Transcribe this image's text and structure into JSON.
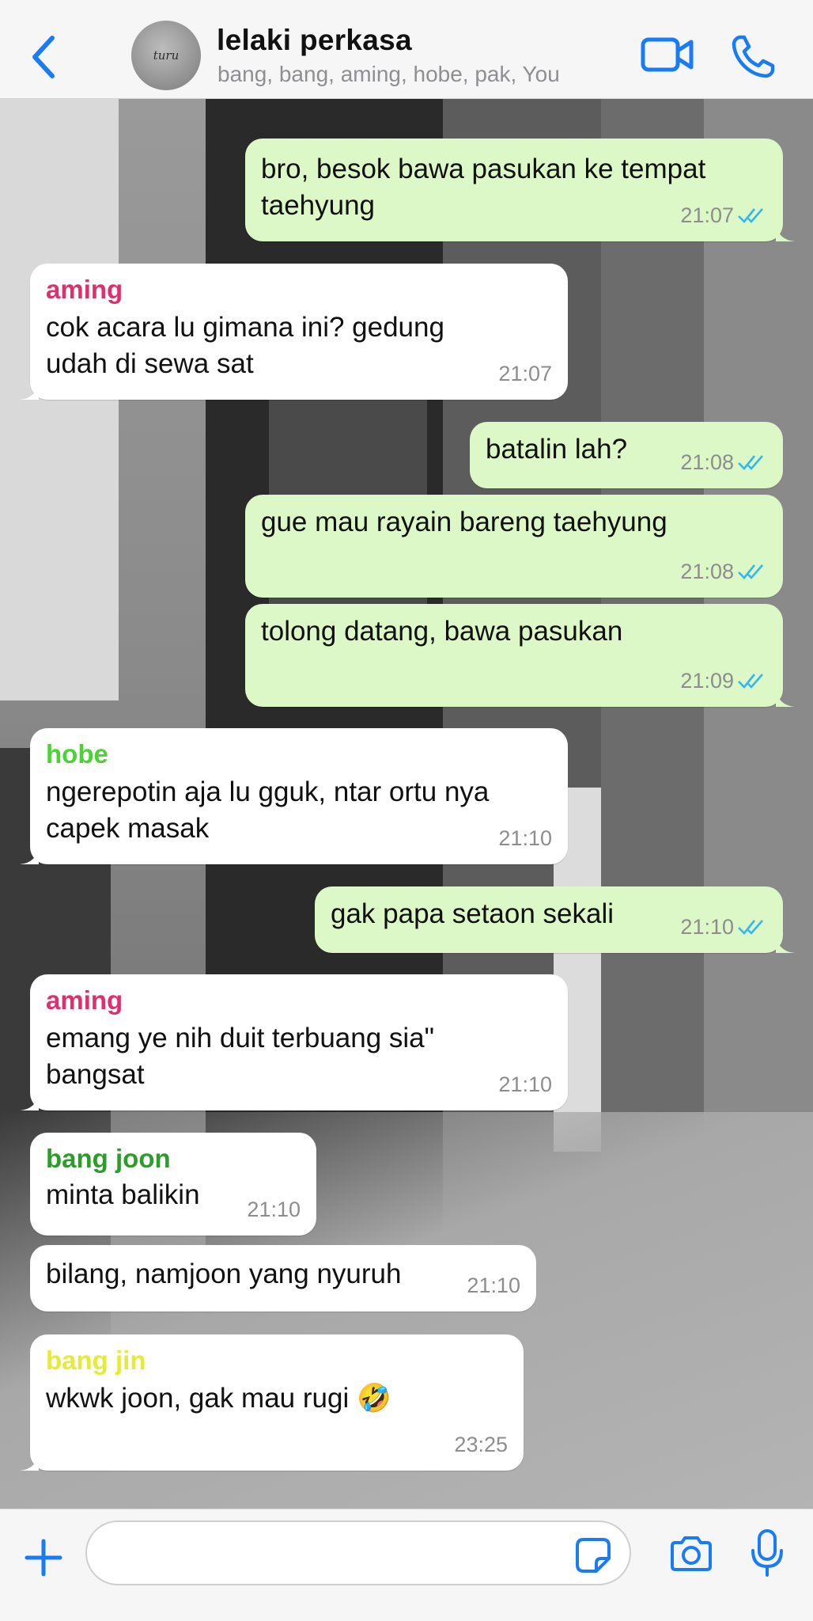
{
  "header": {
    "back_icon": "chevron-left-icon",
    "avatar_text": "turu",
    "title": "lelaki perkasa",
    "subtitle": "bang, bang, aming, hobe, pak, You",
    "video_icon": "video-camera-icon",
    "call_icon": "phone-icon"
  },
  "colors": {
    "accent": "#1a7cf5",
    "outgoing_bubble": "#dcf8c6",
    "incoming_bubble": "#ffffff",
    "read_ticks": "#34b7f1",
    "sender_aming": "#e02f6d",
    "sender_hobe": "#4cd137",
    "sender_bang_joon": "#2d9c2d",
    "sender_bang_jin": "#e6ea3a"
  },
  "messages": [
    {
      "direction": "out",
      "text_lines": [
        "bro, besok bawa pasukan ke tempat",
        "taehyung"
      ],
      "time": "21:07",
      "read": true
    },
    {
      "direction": "in",
      "sender": "aming",
      "text_lines": [
        "cok acara lu gimana ini? gedung",
        "udah di sewa sat"
      ],
      "time": "21:07"
    },
    {
      "direction": "out",
      "text_lines": [
        "batalin lah?"
      ],
      "time": "21:08",
      "read": true
    },
    {
      "direction": "out",
      "text_lines": [
        "gue mau rayain bareng taehyung"
      ],
      "time": "21:08",
      "read": true
    },
    {
      "direction": "out",
      "text_lines": [
        "tolong datang, bawa pasukan"
      ],
      "time": "21:09",
      "read": true
    },
    {
      "direction": "in",
      "sender": "hobe",
      "text_lines": [
        "ngerepotin aja lu gguk, ntar ortu nya",
        "capek masak"
      ],
      "time": "21:10"
    },
    {
      "direction": "out",
      "text_lines": [
        "gak papa setaon sekali"
      ],
      "time": "21:10",
      "read": true
    },
    {
      "direction": "in",
      "sender": "aming",
      "text_lines": [
        "emang ye nih duit terbuang sia\"",
        "bangsat"
      ],
      "time": "21:10"
    },
    {
      "direction": "in",
      "sender": "bang joon",
      "text_lines": [
        "minta balikin"
      ],
      "time": "21:10"
    },
    {
      "direction": "in",
      "text_lines": [
        "bilang, namjoon yang nyuruh"
      ],
      "time": "21:10"
    },
    {
      "direction": "in",
      "sender": "bang jin",
      "text_lines": [
        "wkwk joon, gak mau rugi 🤣"
      ],
      "time": "23:25"
    }
  ],
  "composer": {
    "plus_icon": "plus-icon",
    "input_value": "",
    "input_placeholder": "",
    "sticker_icon": "sticker-icon",
    "camera_icon": "camera-icon",
    "mic_icon": "microphone-icon"
  }
}
